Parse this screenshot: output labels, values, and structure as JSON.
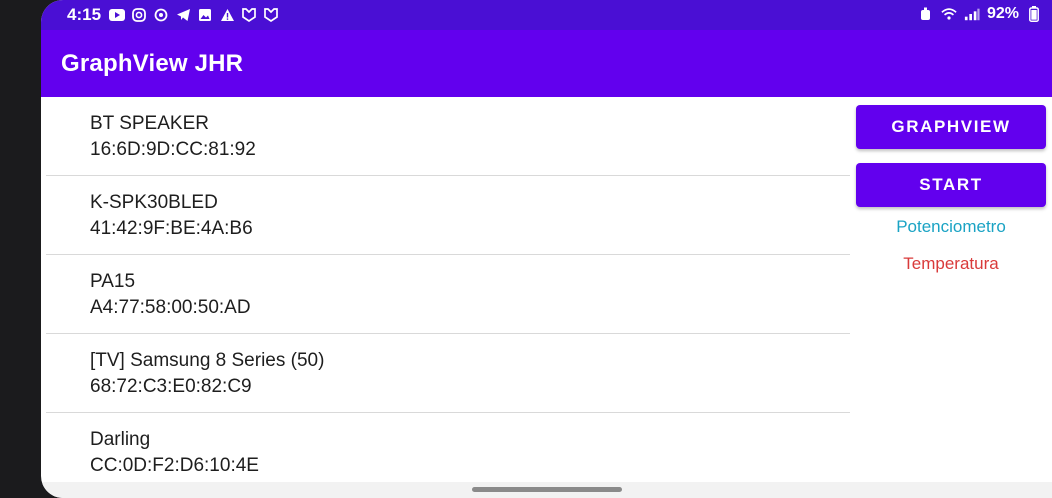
{
  "status_bar": {
    "time": "4:15",
    "battery": "92%",
    "icons_left": [
      "youtube-icon",
      "instagram-icon",
      "threads-icon",
      "telegram-icon",
      "gallery-icon",
      "alert-icon",
      "shield-icon",
      "shield-icon"
    ],
    "icons_right": [
      "alarm-icon",
      "wifi-icon",
      "signal-icon",
      "battery-icon"
    ]
  },
  "app_bar": {
    "title": "GraphView JHR"
  },
  "devices": [
    {
      "name": "BT SPEAKER",
      "mac": "16:6D:9D:CC:81:92"
    },
    {
      "name": "K-SPK30BLED",
      "mac": "41:42:9F:BE:4A:B6"
    },
    {
      "name": "PA15",
      "mac": "A4:77:58:00:50:AD"
    },
    {
      "name": "[TV] Samsung 8 Series (50)",
      "mac": "68:72:C3:E0:82:C9"
    },
    {
      "name": "Darling",
      "mac": "CC:0D:F2:D6:10:4E"
    }
  ],
  "side_panel": {
    "graphview_label": "GRAPHVIEW",
    "start_label": "START",
    "legend": [
      {
        "label": "Potenciometro",
        "color": "#1aa3c4"
      },
      {
        "label": "Temperatura",
        "color": "#d93a3a"
      }
    ]
  },
  "colors": {
    "status_bar": "#4a0fd4",
    "primary": "#6200ee",
    "on_primary": "#ffffff"
  }
}
